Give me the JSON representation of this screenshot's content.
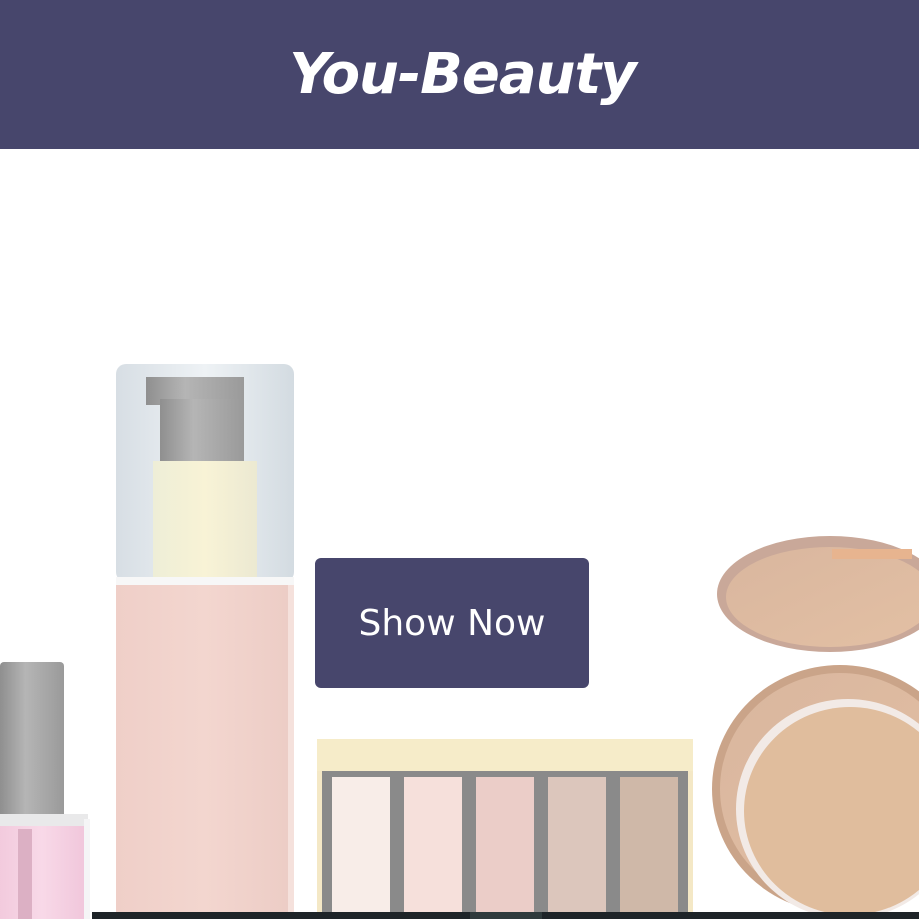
{
  "header": {
    "brand": "You-Beauty",
    "background_color": "#47466c"
  },
  "hero": {
    "cta_label": "Show Now",
    "cta_color": "#47466c",
    "products": [
      "nail-polish-icon",
      "foundation-bottle-icon",
      "eyeshadow-palette-icon",
      "compact-powder-icon"
    ]
  }
}
